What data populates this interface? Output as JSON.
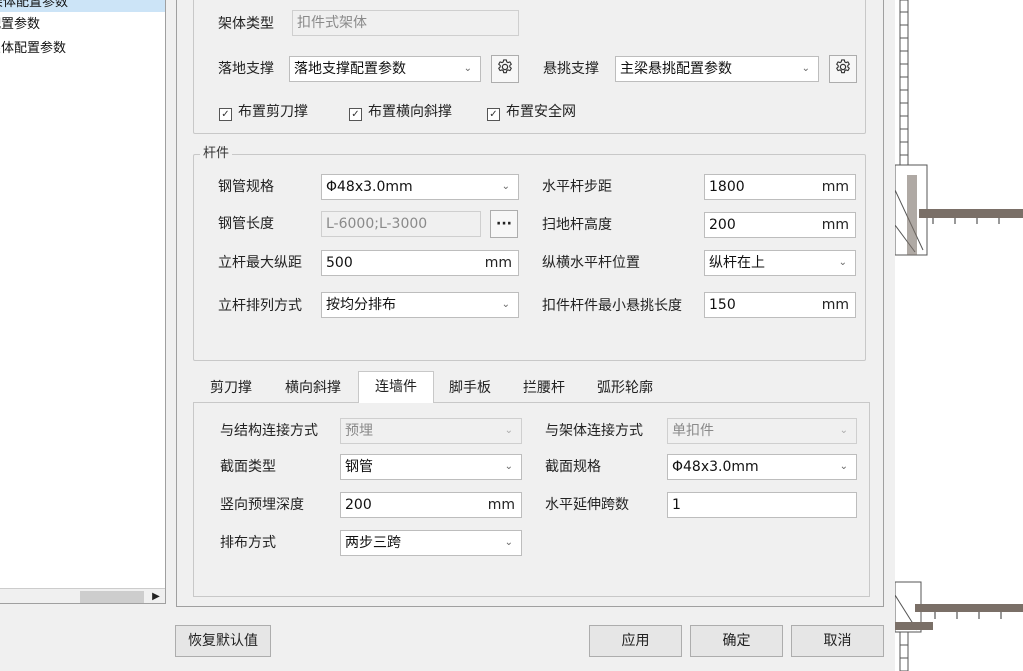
{
  "tree": {
    "items": [
      {
        "label": "架体配置参数",
        "selected": true
      },
      {
        "label": "配置参数",
        "selected": false
      },
      {
        "label": "架体配置参数",
        "selected": false
      }
    ]
  },
  "frame": {
    "type_label": "架体类型",
    "type_value": "扣件式架体",
    "floor_label": "落地支撑",
    "floor_value": "落地支撑配置参数",
    "cantilever_label": "悬挑支撑",
    "cantilever_value": "主梁悬挑配置参数",
    "checkboxes": [
      {
        "label": "布置剪刀撑",
        "checked": true
      },
      {
        "label": "布置横向斜撑",
        "checked": true
      },
      {
        "label": "布置安全网",
        "checked": true
      }
    ]
  },
  "members": {
    "title": "杆件",
    "pipe_spec_label": "钢管规格",
    "pipe_spec_value": "Φ48x3.0mm",
    "pipe_length_label": "钢管长度",
    "pipe_length_value": "L-6000;L-3000",
    "ellipsis": "···",
    "max_spacing_label": "立杆最大纵距",
    "max_spacing_value": "500",
    "arrangement_label": "立杆排列方式",
    "arrangement_value": "按均分排布",
    "step_label": "水平杆步距",
    "step_value": "1800",
    "sweep_height_label": "扫地杆高度",
    "sweep_height_value": "200",
    "position_label": "纵横水平杆位置",
    "position_value": "纵杆在上",
    "min_overhang_label": "扣件杆件最小悬挑长度",
    "min_overhang_value": "150",
    "unit": "mm"
  },
  "tabs": [
    "剪刀撑",
    "横向斜撑",
    "连墙件",
    "脚手板",
    "拦腰杆",
    "弧形轮廓"
  ],
  "active_tab": "连墙件",
  "wall_tie": {
    "struct_conn_label": "与结构连接方式",
    "struct_conn_value": "预埋",
    "frame_conn_label": "与架体连接方式",
    "frame_conn_value": "单扣件",
    "section_type_label": "截面类型",
    "section_type_value": "钢管",
    "section_spec_label": "截面规格",
    "section_spec_value": "Φ48x3.0mm",
    "embed_depth_label": "竖向预埋深度",
    "embed_depth_value": "200",
    "span_count_label": "水平延伸跨数",
    "span_count_value": "1",
    "layout_label": "排布方式",
    "layout_value": "两步三跨",
    "unit": "mm"
  },
  "buttons": {
    "reset": "恢复默认值",
    "apply": "应用",
    "ok": "确定",
    "cancel": "取消"
  },
  "icons": {
    "settings": "gear-icon",
    "dropdown": "chevron-down-icon",
    "scroll_right": "triangle-right-icon"
  },
  "colors": {
    "dialog_bg": "#f0f0f0",
    "selection": "#cce4f7",
    "border": "#c8c8c8",
    "drawing_line": "#7a6f67"
  }
}
